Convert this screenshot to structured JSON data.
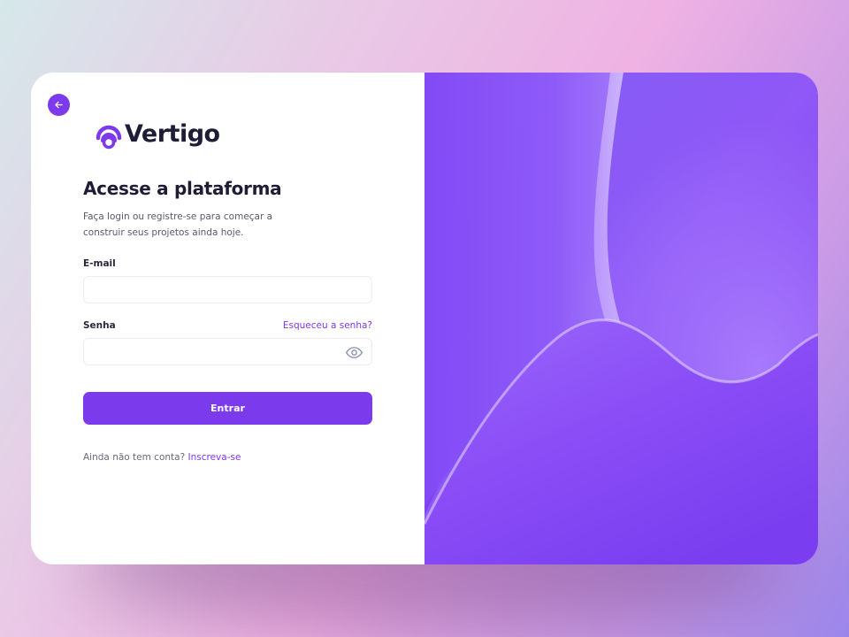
{
  "header": {
    "back_icon": "arrow-left-icon",
    "brand_name": "Vertigo",
    "logo_icon": "signal-ring-icon"
  },
  "form": {
    "title": "Acesse a plataforma",
    "subtitle": "Faça login ou registre-se para começar a construir seus projetos ainda hoje.",
    "email_label": "E-mail",
    "email_value": "",
    "password_label": "Senha",
    "password_value": "",
    "forgot_link": "Esqueceu a senha?",
    "toggle_icon": "eye-icon",
    "submit_label": "Entrar",
    "signup_prompt": "Ainda não tem conta?",
    "signup_link": "Inscreva-se"
  },
  "colors": {
    "accent": "#7c3aed",
    "heading": "#1f1d36",
    "art_base": "#8b5cf6"
  }
}
